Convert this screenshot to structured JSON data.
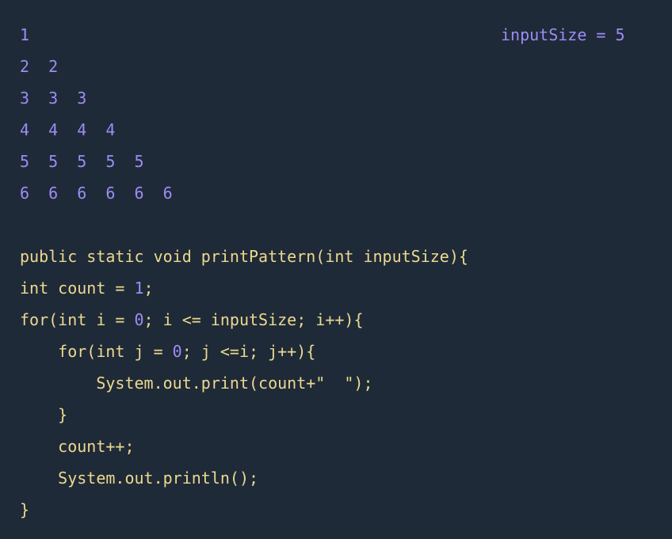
{
  "output_lines": [
    "1",
    "2  2",
    "3  3  3",
    "4  4  4  4",
    "5  5  5  5  5",
    "6  6  6  6  6  6"
  ],
  "annotation": {
    "label": "inputSize = ",
    "value": "5"
  },
  "code": [
    {
      "indent": "",
      "parts": [
        {
          "t": "public static void printPattern(int inputSize){",
          "k": "txt"
        }
      ]
    },
    {
      "indent": "",
      "parts": [
        {
          "t": "int count = ",
          "k": "txt"
        },
        {
          "t": "1",
          "k": "num"
        },
        {
          "t": ";",
          "k": "txt"
        }
      ]
    },
    {
      "indent": "",
      "parts": [
        {
          "t": "for(int i = ",
          "k": "txt"
        },
        {
          "t": "0",
          "k": "num"
        },
        {
          "t": "; i <= inputSize; i++){",
          "k": "txt"
        }
      ]
    },
    {
      "indent": "    ",
      "parts": [
        {
          "t": "for(int j = ",
          "k": "txt"
        },
        {
          "t": "0",
          "k": "num"
        },
        {
          "t": "; j <=i; j++){",
          "k": "txt"
        }
      ]
    },
    {
      "indent": "        ",
      "parts": [
        {
          "t": "System.out.print(count+\"  \");",
          "k": "txt"
        }
      ]
    },
    {
      "indent": "    ",
      "parts": [
        {
          "t": "}",
          "k": "txt"
        }
      ]
    },
    {
      "indent": "    ",
      "parts": [
        {
          "t": "count++;",
          "k": "txt"
        }
      ]
    },
    {
      "indent": "    ",
      "parts": [
        {
          "t": "System.out.println();",
          "k": "txt"
        }
      ]
    },
    {
      "indent": "",
      "parts": [
        {
          "t": "}",
          "k": "txt"
        }
      ]
    }
  ],
  "colors": {
    "background": "#1f2a38",
    "number": "#9d8cf5",
    "text": "#ecd98f"
  }
}
